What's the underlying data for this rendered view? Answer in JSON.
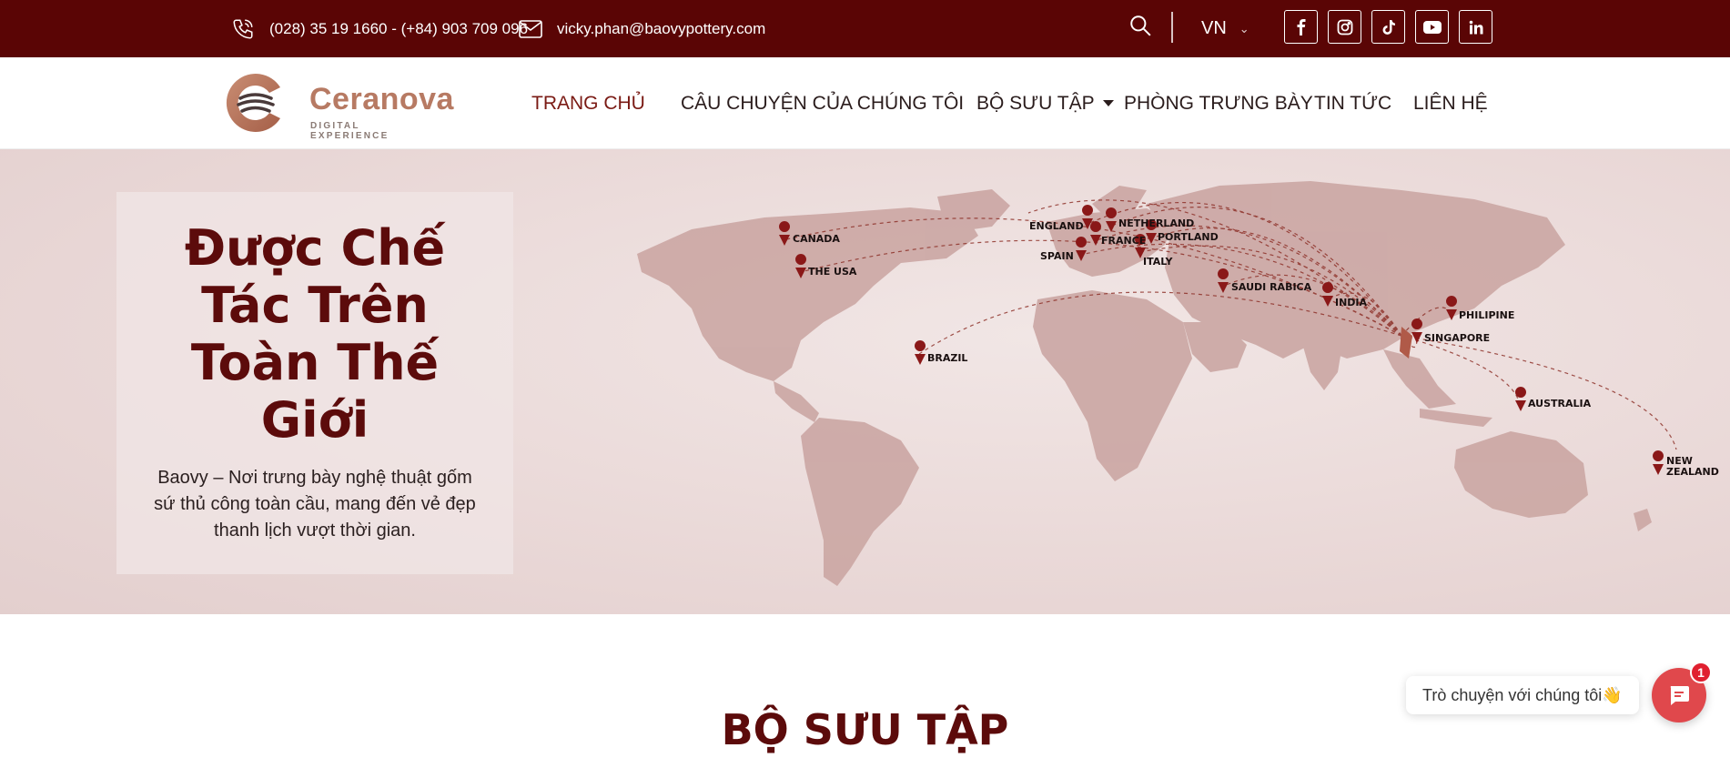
{
  "topbar": {
    "phone": "(028) 35 19 1660 - (+84) 903 709 096",
    "email": "vicky.phan@baovypottery.com",
    "language": "VN",
    "socials": [
      "facebook-icon",
      "instagram-icon",
      "tiktok-icon",
      "youtube-icon",
      "linkedin-icon"
    ]
  },
  "brand": {
    "name": "Ceranova",
    "tagline": "DIGITAL EXPERIENCE"
  },
  "nav": {
    "items": [
      {
        "label": "TRANG CHỦ",
        "active": true
      },
      {
        "label": "CÂU CHUYỆN CỦA CHÚNG TÔI"
      },
      {
        "label": "BỘ SƯU TẬP",
        "dropdown": true
      },
      {
        "label": "PHÒNG TRƯNG BÀY"
      },
      {
        "label": "TIN TỨC"
      },
      {
        "label": "LIÊN HỆ"
      }
    ]
  },
  "hero": {
    "title": "Được Chế Tác Trên Toàn Thế Giới",
    "description": "Baovy – Nơi trưng bày nghệ thuật gốm sứ thủ công toàn cầu, mang đến vẻ đẹp thanh lịch vượt thời gian.",
    "map_locations": [
      "CANADA",
      "THE USA",
      "BRAZIL",
      "ENGLAND",
      "NETHERLAND",
      "FRANCE",
      "PORTLAND",
      "SPAIN",
      "ITALY",
      "SAUDI RABICA",
      "INDIA",
      "PHILIPINE",
      "SINGAPORE",
      "AUSTRALIA",
      "NEW",
      "ZEALAND"
    ]
  },
  "section": {
    "title": "BỘ SƯU TẬP"
  },
  "chat": {
    "prompt": "Trò chuyện với chúng tôi👋",
    "badge": "1"
  },
  "colors": {
    "primary": "#5a0505",
    "accent": "#b77a63",
    "chat": "#e0484c"
  }
}
